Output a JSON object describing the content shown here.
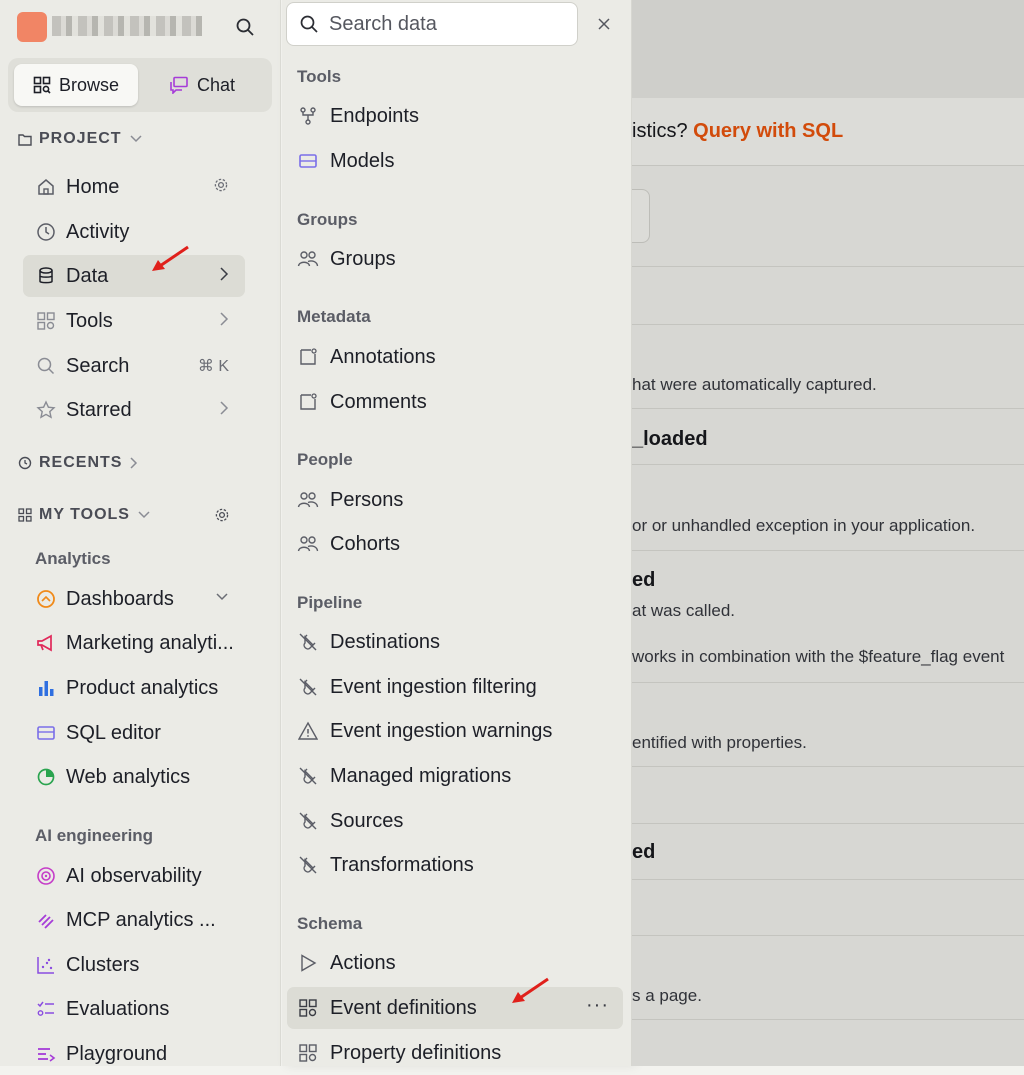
{
  "sidebar": {
    "browse_label": "Browse",
    "chat_label": "Chat",
    "project_heading": "PROJECT",
    "project_items": [
      {
        "label": "Home",
        "icon": "home-icon"
      },
      {
        "label": "Activity",
        "icon": "clock-icon"
      },
      {
        "label": "Data",
        "icon": "database-icon"
      },
      {
        "label": "Tools",
        "icon": "grid-icon"
      },
      {
        "label": "Search",
        "icon": "search-icon",
        "shortcut": "⌘ K"
      },
      {
        "label": "Starred",
        "icon": "star-icon"
      }
    ],
    "recents_heading": "RECENTS",
    "my_tools_heading": "MY TOOLS",
    "analytics_label": "Analytics",
    "analytics_items": [
      {
        "label": "Dashboards",
        "icon": "gauge-icon"
      },
      {
        "label": "Marketing analyti...",
        "icon": "megaphone-icon"
      },
      {
        "label": "Product analytics",
        "icon": "bar-chart-icon"
      },
      {
        "label": "SQL editor",
        "icon": "sql-editor-icon"
      },
      {
        "label": "Web analytics",
        "icon": "pie-chart-icon"
      }
    ],
    "ai_label": "AI engineering",
    "ai_items": [
      {
        "label": "AI observability",
        "icon": "eye-target-icon"
      },
      {
        "label": "MCP analytics ...",
        "icon": "mcp-icon"
      },
      {
        "label": "Clusters",
        "icon": "scatter-icon"
      },
      {
        "label": "Evaluations",
        "icon": "checklist-icon"
      },
      {
        "label": "Playground",
        "icon": "playground-icon"
      }
    ]
  },
  "panel": {
    "search_placeholder": "Search data",
    "groups": [
      {
        "label": "Tools",
        "items": [
          {
            "label": "Endpoints",
            "icon": "endpoints-icon"
          },
          {
            "label": "Models",
            "icon": "models-icon"
          }
        ]
      },
      {
        "label": "Groups",
        "items": [
          {
            "label": "Groups",
            "icon": "people-icon"
          }
        ]
      },
      {
        "label": "Metadata",
        "items": [
          {
            "label": "Annotations",
            "icon": "annotation-icon"
          },
          {
            "label": "Comments",
            "icon": "comment-icon"
          }
        ]
      },
      {
        "label": "People",
        "items": [
          {
            "label": "Persons",
            "icon": "people-icon"
          },
          {
            "label": "Cohorts",
            "icon": "people-icon"
          }
        ]
      },
      {
        "label": "Pipeline",
        "items": [
          {
            "label": "Destinations",
            "icon": "plug-icon"
          },
          {
            "label": "Event ingestion filtering",
            "icon": "plug-icon"
          },
          {
            "label": "Event ingestion warnings",
            "icon": "warning-icon"
          },
          {
            "label": "Managed migrations",
            "icon": "plug-icon"
          },
          {
            "label": "Sources",
            "icon": "plug-icon"
          },
          {
            "label": "Transformations",
            "icon": "plug-icon"
          }
        ]
      },
      {
        "label": "Schema",
        "items": [
          {
            "label": "Actions",
            "icon": "play-icon"
          },
          {
            "label": "Event definitions",
            "icon": "grid-icon"
          },
          {
            "label": "Property definitions",
            "icon": "grid-icon"
          }
        ]
      }
    ],
    "more_label": "···"
  },
  "main": {
    "sql_prompt": "istics?",
    "sql_link": "Query with SQL",
    "link_color": "#d24b0b",
    "lines": [
      "hat were automatically captured.",
      "_loaded",
      "or or unhandled exception in your application.",
      "ed",
      "at was called.",
      "works in combination with the $feature_flag event",
      "entified with properties.",
      "ed",
      "s a page."
    ]
  },
  "accent": "#f2734e",
  "annotation_arrow_color": "#e0201b"
}
